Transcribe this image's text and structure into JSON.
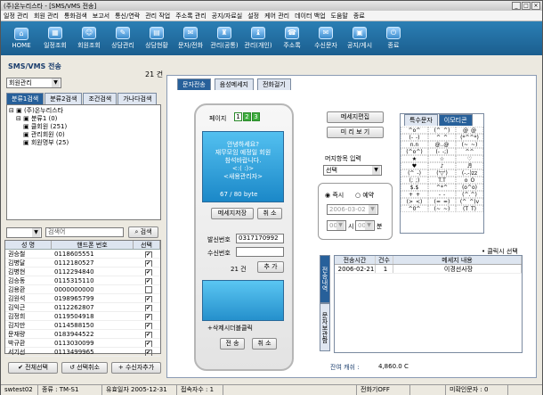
{
  "window": {
    "title": "(주)온누리스타 - [SMS/VMS 전송]"
  },
  "menu": [
    "일정 관리",
    "회원 관리",
    "통화검색",
    "보고서",
    "통신/연락",
    "관리 작업",
    "주소록 관리",
    "공지/자료실",
    "설정",
    "케어 관리",
    "데이터 백업",
    "도움말",
    "종료"
  ],
  "toolbar": [
    "HOME",
    "일정조회",
    "회원조회",
    "상담관리",
    "상담현황",
    "문자/전화",
    "관리(공통)",
    "관리(개인)",
    "주소록",
    "수신문자",
    "공지/게시",
    "종료"
  ],
  "left": {
    "title": "SMS/VMS 전송",
    "count": "21 건",
    "group_select": "회원관리",
    "tabs": [
      "분류1검색",
      "분류2검색",
      "조건검색",
      "가나다검색"
    ],
    "tree": [
      "(주)온누리스타",
      "분류1 (0)",
      "클회원 (251)",
      "관리회원 (0)",
      "회원명부 (25)"
    ],
    "search_value": "검색어",
    "search_btn": "검색",
    "grid_headers": [
      "성 명",
      "핸드폰 번호",
      "선택"
    ],
    "rows": [
      [
        "권승철",
        "0118605551",
        "✔"
      ],
      [
        "김병달",
        "0112180527",
        "✔"
      ],
      [
        "김병현",
        "0112294840",
        "✔"
      ],
      [
        "김승동",
        "0115315110",
        "✔"
      ],
      [
        "김용환",
        "0000000000",
        ""
      ],
      [
        "김원석",
        "0198965799",
        "✔"
      ],
      [
        "김익근",
        "0112262807",
        "✔"
      ],
      [
        "김정희",
        "0119504918",
        "✔"
      ],
      [
        "김지만",
        "0114588150",
        "✔"
      ],
      [
        "문재량",
        "0183944522",
        "✔"
      ],
      [
        "박규환",
        "0113030099",
        "✔"
      ],
      [
        "서기선",
        "0113499965",
        "✔"
      ]
    ],
    "btn_all": "전체선택",
    "btn_cancel": "선택취소",
    "btn_add": "수신자추가"
  },
  "main": {
    "tabs": [
      "문자전송",
      "음성메세지",
      "전화걸기"
    ],
    "page_label": "페이지",
    "pages": [
      "1",
      "2",
      "3"
    ],
    "message": "안녕하세요?|재무모임 예정일 회원|참석바랍니다.|<:(  :)>|<새용관리자>",
    "byte": "67 / 80 byte",
    "save_btn": "메세지저장",
    "cancel_btn": "취 소",
    "sender_label": "발신번호",
    "sender_value": "0317170992",
    "receiver_label": "수신번호",
    "recv_count": "21 건",
    "add_btn": "추 가",
    "hint": "+삭제시더블클릭",
    "send_btn": "전 송",
    "cancel2_btn": "취 소",
    "edit_btn": "메세지편집",
    "preview_btn": "미 리 보 기",
    "insert_label": "머지항목 입력",
    "insert_select": "선택",
    "radio_now": "즉시",
    "radio_reserve": "예약",
    "date_value": "2006-03-02",
    "hour_value": "00",
    "hour_label": "시",
    "min_value": "00",
    "min_label": "분",
    "spec_tabs": [
      "특수문자",
      "이모티콘"
    ],
    "emoticons": [
      "^o^",
      "(^_^)",
      "@_@",
      "(-_-)",
      "^_^",
      "(*^^*)",
      "n.n",
      "@..@",
      "(~_~)",
      "(^o^)",
      "(-_-;)",
      "^^",
      "★",
      "☆",
      "♡",
      "♥",
      "♪",
      "♬",
      "(^_-)",
      "('▽')",
      "(-.-)zz",
      "(;_;)",
      "T.T",
      "o_O",
      "$.$",
      "^*^",
      "(o^o)",
      "+_+",
      "-_-",
      "(^.^)",
      "(>_<)",
      "(=_=)",
      "(^_^)v",
      "^0^",
      "(~_~)",
      "(T_T)"
    ],
    "click_hint": "• 클릭시 선택",
    "hist_headers": [
      "전송시간",
      "건수",
      "메세지 내용"
    ],
    "hist_rows": [
      [
        "2006-02-21",
        "1",
        "이경선사장"
      ]
    ],
    "side_tabs": [
      "전송내역",
      "문자보관함"
    ],
    "remain_label": "잔여 캐쉬 :",
    "remain_value": "4,860.0 C"
  },
  "status": [
    "swtest02",
    "종류 : TM-S1",
    "유효일자 2005-12-31",
    "접속자수 : 1",
    "",
    "전화기OFF",
    "",
    "미확인문자 : 0"
  ]
}
